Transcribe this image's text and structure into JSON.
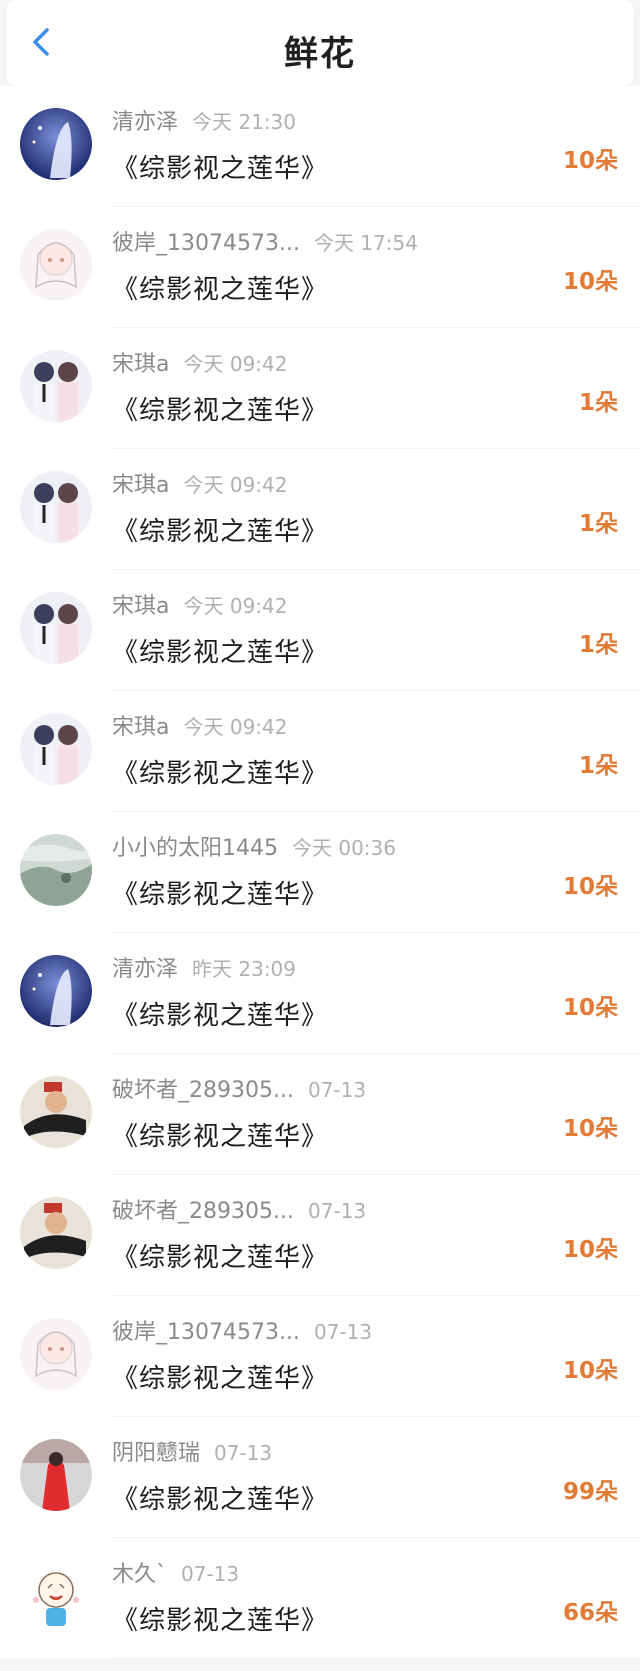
{
  "header": {
    "title": "鲜花"
  },
  "rows": [
    {
      "user": "清亦泽",
      "time": "今天 21:30",
      "book": "《综影视之莲华》",
      "count": "10朵"
    },
    {
      "user": "彼岸_13074573...",
      "time": "今天 17:54",
      "book": "《综影视之莲华》",
      "count": "10朵"
    },
    {
      "user": "宋琪a",
      "time": "今天 09:42",
      "book": "《综影视之莲华》",
      "count": "1朵"
    },
    {
      "user": "宋琪a",
      "time": "今天 09:42",
      "book": "《综影视之莲华》",
      "count": "1朵"
    },
    {
      "user": "宋琪a",
      "time": "今天 09:42",
      "book": "《综影视之莲华》",
      "count": "1朵"
    },
    {
      "user": "宋琪a",
      "time": "今天 09:42",
      "book": "《综影视之莲华》",
      "count": "1朵"
    },
    {
      "user": "小小的太阳1445",
      "time": "今天 00:36",
      "book": "《综影视之莲华》",
      "count": "10朵"
    },
    {
      "user": "清亦泽",
      "time": "昨天 23:09",
      "book": "《综影视之莲华》",
      "count": "10朵"
    },
    {
      "user": "破坏者_289305...",
      "time": "07-13",
      "book": "《综影视之莲华》",
      "count": "10朵"
    },
    {
      "user": "破坏者_289305...",
      "time": "07-13",
      "book": "《综影视之莲华》",
      "count": "10朵"
    },
    {
      "user": "彼岸_13074573...",
      "time": "07-13",
      "book": "《综影视之莲华》",
      "count": "10朵"
    },
    {
      "user": "阴阳戆瑞",
      "time": "07-13",
      "book": "《综影视之莲华》",
      "count": "99朵"
    },
    {
      "user": "木久`",
      "time": "07-13",
      "book": "《综影视之莲华》",
      "count": "66朵"
    }
  ],
  "colors": {
    "accent_blue": "#3a8fe8",
    "count_orange": "#e37a35"
  },
  "icons": {
    "back": "chevron-left-icon"
  }
}
